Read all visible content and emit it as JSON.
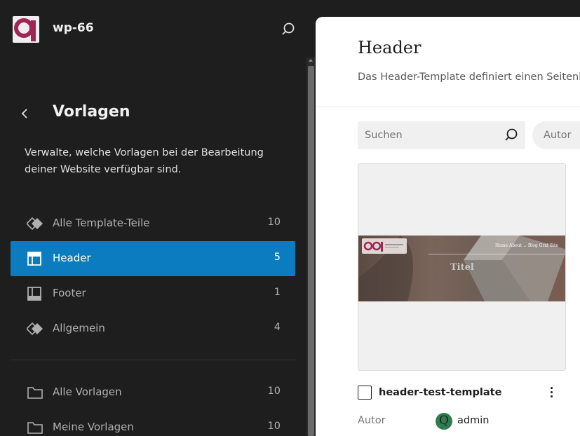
{
  "site": {
    "title": "wp-66"
  },
  "sidebar": {
    "back_label": "‹",
    "title": "Vorlagen",
    "description": "Verwalte, welche Vorlagen bei der Bearbeitung deiner Website verfügbar sind.",
    "items": [
      {
        "label": "Alle Template-Teile",
        "count": "10",
        "icon": "diamond-icon"
      },
      {
        "label": "Header",
        "count": "5",
        "icon": "header-layout-icon",
        "active": true
      },
      {
        "label": "Footer",
        "count": "1",
        "icon": "footer-layout-icon"
      },
      {
        "label": "Allgemein",
        "count": "4",
        "icon": "diamond-icon"
      },
      {
        "label": "Alle Vorlagen",
        "count": "10",
        "icon": "folder-icon"
      },
      {
        "label": "Meine Vorlagen",
        "count": "10",
        "icon": "folder-icon"
      }
    ]
  },
  "main": {
    "title": "Header",
    "description": "Das Header-Template definiert einen Seitenb",
    "search": {
      "placeholder": "Suchen"
    },
    "author_filter": "Autor",
    "card": {
      "title": "header-test-template",
      "author_label": "Autor",
      "author_name": "admin",
      "author_initial": "Q",
      "preview": {
        "nav": "Home  About ⌄  Blog  Grid Site",
        "heading": "Titel"
      }
    }
  },
  "colors": {
    "accent": "#0a7cbf",
    "sidebar_bg": "#1e1e1e",
    "main_bg": "#ffffff"
  }
}
